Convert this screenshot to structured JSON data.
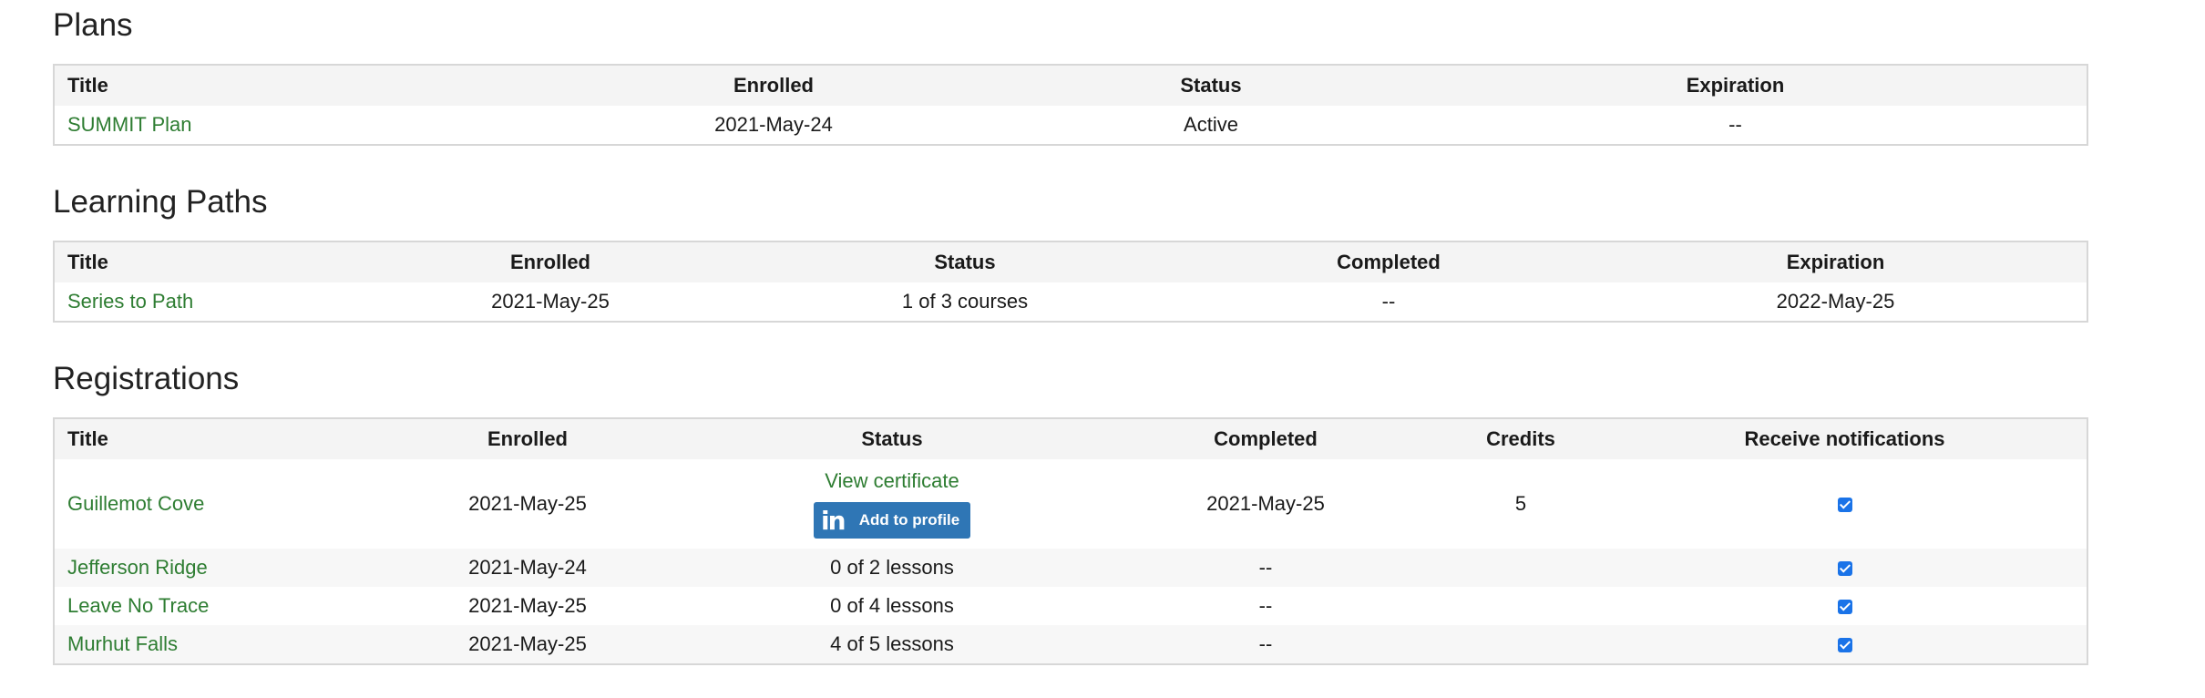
{
  "plans": {
    "heading": "Plans",
    "columns": [
      "Title",
      "Enrolled",
      "Status",
      "Expiration"
    ],
    "rows": [
      {
        "title": "SUMMIT Plan",
        "enrolled": "2021-May-24",
        "status": "Active",
        "expiration": "--"
      }
    ]
  },
  "learning_paths": {
    "heading": "Learning Paths",
    "columns": [
      "Title",
      "Enrolled",
      "Status",
      "Completed",
      "Expiration"
    ],
    "rows": [
      {
        "title": "Series to Path",
        "enrolled": "2021-May-25",
        "status": "1 of 3 courses",
        "completed": "--",
        "expiration": "2022-May-25"
      }
    ]
  },
  "registrations": {
    "heading": "Registrations",
    "columns": [
      "Title",
      "Enrolled",
      "Status",
      "Completed",
      "Credits",
      "Receive notifications"
    ],
    "rows": [
      {
        "title": "Guillemot Cove",
        "enrolled": "2021-May-25",
        "status_link": "View certificate",
        "linkedin_icon": "in",
        "linkedin_label": "Add to profile",
        "completed": "2021-May-25",
        "credits": "5",
        "notify": true
      },
      {
        "title": "Jefferson Ridge",
        "enrolled": "2021-May-24",
        "status": "0 of 2 lessons",
        "completed": "--",
        "credits": "",
        "notify": true
      },
      {
        "title": "Leave No Trace",
        "enrolled": "2021-May-25",
        "status": "0 of 4 lessons",
        "completed": "--",
        "credits": "",
        "notify": true
      },
      {
        "title": "Murhut Falls",
        "enrolled": "2021-May-25",
        "status": "4 of 5 lessons",
        "completed": "--",
        "credits": "",
        "notify": true
      }
    ]
  },
  "colors": {
    "link": "#2e7d32",
    "linkedin": "#2f76b5",
    "checkbox": "#1a73e8",
    "header_bg": "#f4f4f4",
    "border": "#d7d7d7"
  }
}
